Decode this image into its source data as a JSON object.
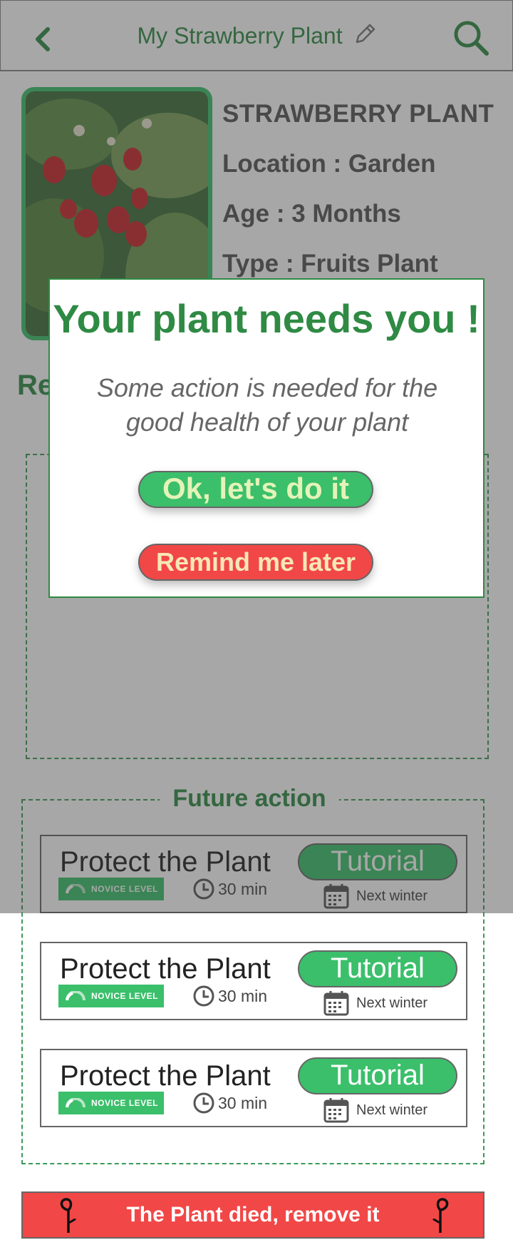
{
  "header": {
    "title": "My Strawberry Plant"
  },
  "plant": {
    "name": "STRAWBERRY PLANT",
    "location": "Location : Garden",
    "age": "Age : 3 Months",
    "type": "Type : Fruits Plant"
  },
  "recommendation": {
    "title_partial": "Re"
  },
  "future": {
    "title": "Future action",
    "cards": [
      {
        "name": "Protect the Plant",
        "level": "NOVICE LEVEL",
        "duration": "30 min",
        "button": "Tutorial",
        "when": "Next winter"
      },
      {
        "name": "Protect the Plant",
        "level": "NOVICE LEVEL",
        "duration": "30 min",
        "button": "Tutorial",
        "when": "Next winter"
      },
      {
        "name": "Protect the Plant",
        "level": "NOVICE LEVEL",
        "duration": "30 min",
        "button": "Tutorial",
        "when": "Next winter"
      }
    ]
  },
  "remove": {
    "label": "The Plant died, remove it"
  },
  "modal": {
    "title": "Your plant needs you !",
    "text": "Some action is needed for the good health of your plant",
    "ok_label": "Ok, let's do it",
    "later_label": "Remind me later"
  },
  "colors": {
    "accent_green": "#3bbf6b",
    "title_green": "#2f8a44",
    "danger_red": "#f24747"
  }
}
